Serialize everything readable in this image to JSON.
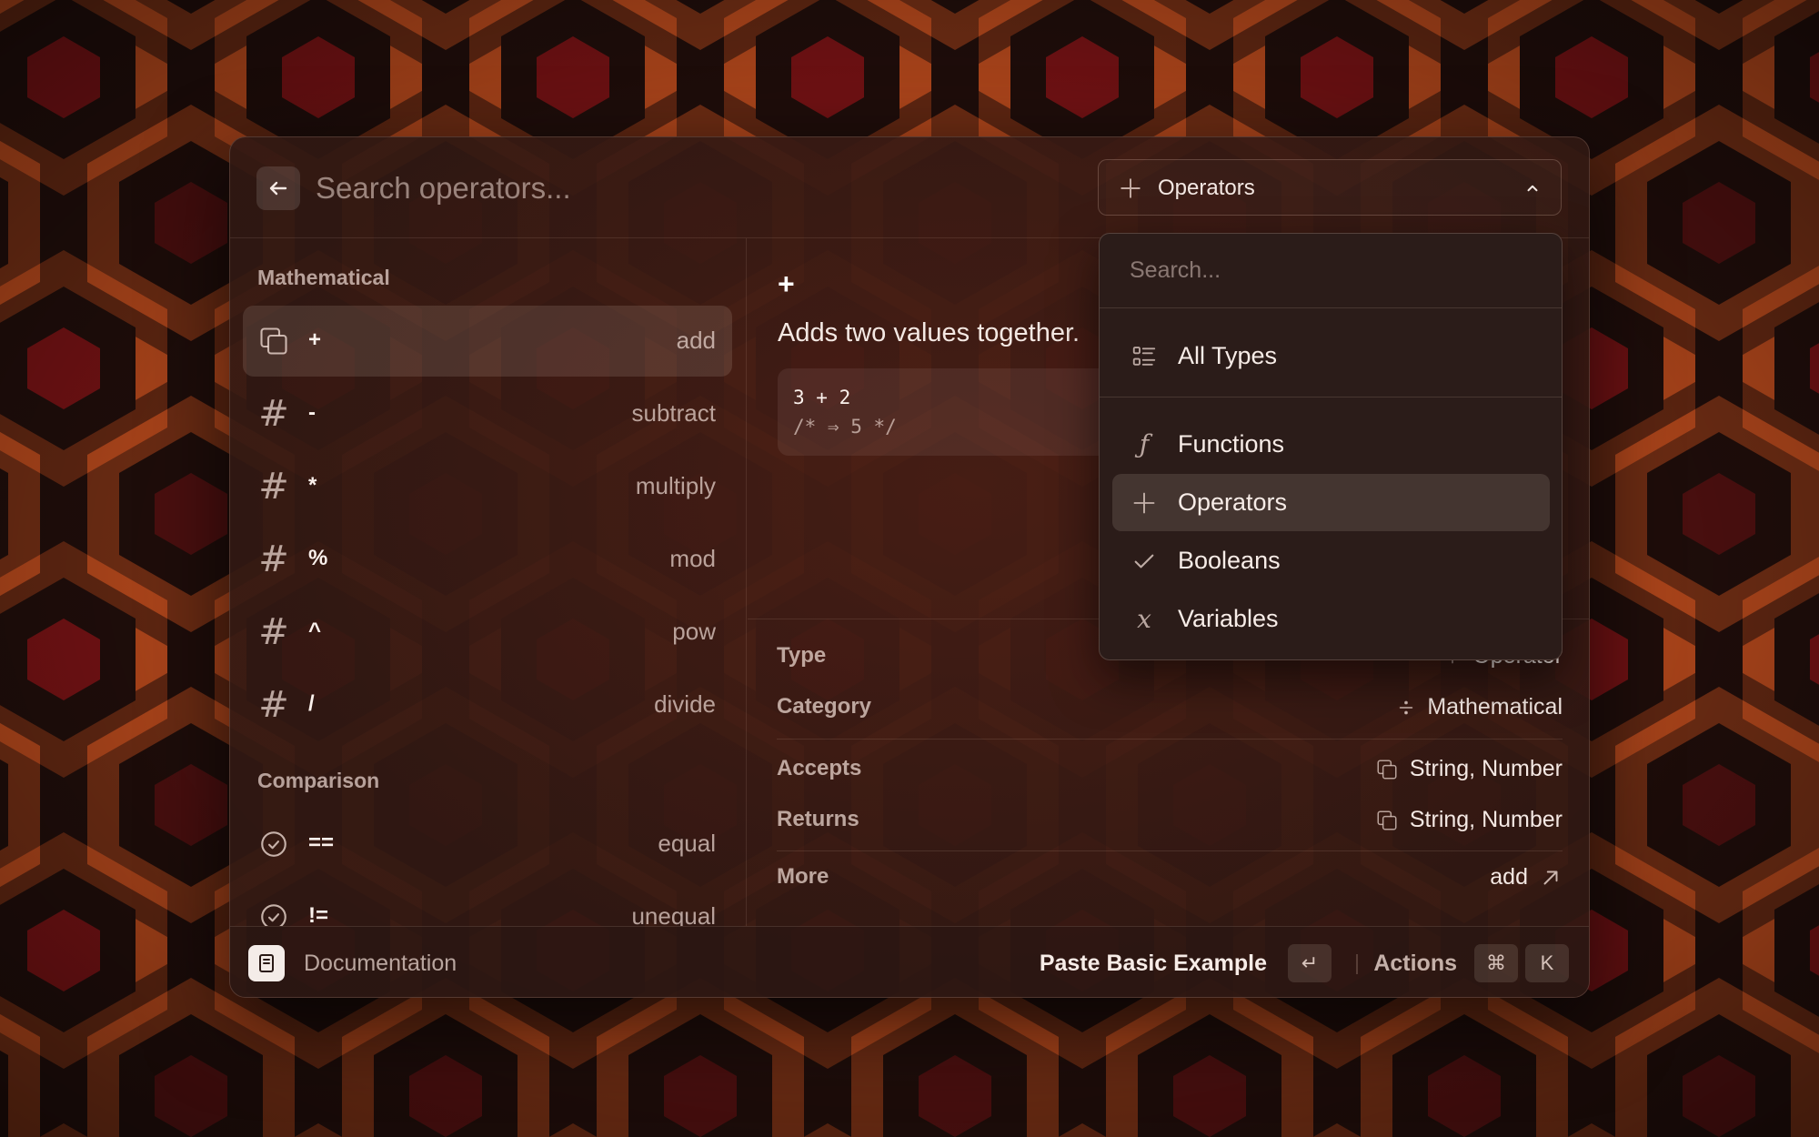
{
  "search": {
    "placeholder": "Search operators..."
  },
  "type_filter": {
    "selected": "Operators",
    "icon": "plus-icon"
  },
  "list": {
    "sections": [
      {
        "title": "Mathematical",
        "items": [
          {
            "icon": "copy-icon",
            "symbol": "+",
            "name": "add",
            "selected": true
          },
          {
            "icon": "hash-icon",
            "symbol": "-",
            "name": "subtract"
          },
          {
            "icon": "hash-icon",
            "symbol": "*",
            "name": "multiply"
          },
          {
            "icon": "hash-icon",
            "symbol": "%",
            "name": "mod"
          },
          {
            "icon": "hash-icon",
            "symbol": "^",
            "name": "pow"
          },
          {
            "icon": "hash-icon",
            "symbol": "/",
            "name": "divide"
          }
        ]
      },
      {
        "title": "Comparison",
        "items": [
          {
            "icon": "check-circle-icon",
            "symbol": "==",
            "name": "equal"
          },
          {
            "icon": "check-circle-icon",
            "symbol": "!=",
            "name": "unequal"
          }
        ]
      }
    ]
  },
  "detail": {
    "symbol": "+",
    "description": "Adds two values together.",
    "example_code": "3 + 2",
    "example_result": "/* ⇒ 5 */",
    "meta": {
      "type": {
        "label": "Type",
        "value": "Operator"
      },
      "category": {
        "label": "Category",
        "value": "Mathematical"
      },
      "accepts": {
        "label": "Accepts",
        "value": "String, Number"
      },
      "returns": {
        "label": "Returns",
        "value": "String, Number"
      },
      "more": {
        "label": "More",
        "value": "add"
      }
    }
  },
  "dropdown": {
    "search_placeholder": "Search...",
    "items": [
      {
        "label": "All Types",
        "icon": "list-icon"
      },
      {
        "label": "Functions",
        "icon": "function-icon"
      },
      {
        "label": "Operators",
        "icon": "plus-icon",
        "selected": true
      },
      {
        "label": "Booleans",
        "icon": "check-icon"
      },
      {
        "label": "Variables",
        "icon": "variable-icon"
      }
    ]
  },
  "footer": {
    "doc_label": "Documentation",
    "primary_action": "Paste Basic Example",
    "primary_shortcut": "↵",
    "actions_label": "Actions",
    "actions_shortcut_mod": "⌘",
    "actions_shortcut_key": "K"
  },
  "colors": {
    "wallpaper_dark": "#1f0d0a",
    "wallpaper_orange": "#b04518",
    "wallpaper_red": "#7a1114",
    "window_bg": "#32191a"
  }
}
